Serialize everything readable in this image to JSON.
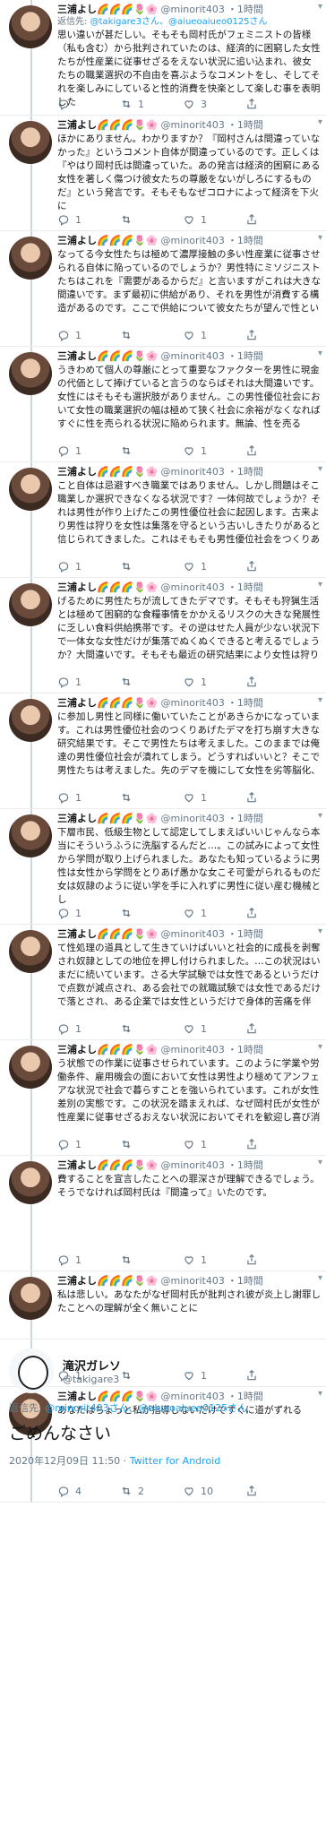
{
  "user": {
    "name": "三浦よし🌈🌈🌈🌷🌸",
    "handle": "@minorit403",
    "time": "・1時間"
  },
  "tweets": [
    {
      "reply_label": "返信先:",
      "reply_to": "@takigare3さん、@aiueoaiueo0125さん",
      "text": "思い違いが甚だしい。そもそも岡村氏がフェミニストの皆様（私も含む）から批判されていたのは、経済的に困窮した女性たちが性産業に従事せざるをえない状況に追い込まれ、彼女たちの職業選択の不自由を喜ぶようなコメントをし、そしてそれを楽しみにしていると性的消費を快楽として楽しむ事を表明した",
      "replies": "",
      "retweets": "1",
      "likes": "3"
    },
    {
      "text": "ほかにありません。わかりますか？『岡村さんは間違っていなかった』というコメント自体が間違っているのです。正しくは『やはり岡村氏は間違っていた。あの発言は経済的困窮にある女性を著しく傷つけ彼女たちの尊厳をないがしろにするものだ』という発言です。そもそもなぜコロナによって経済を下火に",
      "replies": "1",
      "retweets": "",
      "likes": "1"
    },
    {
      "text": "なってる今女性たちは極めて濃厚接触の多い性産業に従事させられる自体に陥っているのでしょうか？男性特にミソジニストたちはこれを『需要があるからだ』と言いますがこれは大きな間違いです。まず最初に供給があり、それを男性が消費する構造があるのです。ここで供給について彼女たちが望んで性とい",
      "replies": "1",
      "retweets": "",
      "likes": "1"
    },
    {
      "text": "うきわめて個人の尊厳にとって重要なファクターを男性に現金の代価として捧げていると言うのならばそれは大間違いです。女性にはそもそも選択肢がありません。この男性優位社会において女性の職業選択の幅は極めて狭く社会に余裕がなくなればすぐに性を売られる状況に陥められます。無論、性を売る",
      "replies": "1",
      "retweets": "",
      "likes": "1"
    },
    {
      "text": "こと自体は忌避すべき職業ではありません。しかし問題はそこ職業しか選択できなくなる状況です？一体何故でしょうか？それは男性が作り上げたこの男性優位社会に起因します。古来より男性は狩りを女性は集落を守るという古いしきたりがあると信じられてきました。これはそもそも男性優位社会をつくりあ",
      "replies": "1",
      "retweets": "",
      "likes": "1"
    },
    {
      "text": "げるために男性たちが流してきたデマです。そもそも狩猟生活とは極めて困窮的な食糧事情をかかえるリスクの大きな発展性に乏しい食料供給携帯です。その逆はせた人員が少ない状況下で一体女な女性だけが集落でぬくぬくできると考えるでしょうか？大間違いです。そもそも最近の研究結果により女性は狩り",
      "replies": "1",
      "retweets": "",
      "likes": "1"
    },
    {
      "text": "に参加し男性と同様に働いていたことがあきらかになっています。これは男性優位社会のつくりあげたデマを打ち崩す大きな研究結果です。そこで男性たちは考えました。このままでは俺達の男性優位社会が潰れてしまう。どうすればいいと？そこで男性たちは考えました。先のデマを機にして女性を劣等脳化、",
      "replies": "1",
      "retweets": "",
      "likes": "1"
    },
    {
      "text": "下層市民、低級生物として認定してしまえばいいじゃんなら本当にそういうふうに洗脳するんだと…。この試みによって女性から学問が取り上げられました。あなたも知っているように男性は女性から学問をとりあげ愚かな女こそ可愛がられるものだ女は奴隷のように従い学を手に入れずに男性に従い産む機械とし",
      "replies": "1",
      "retweets": "",
      "likes": "1"
    },
    {
      "text": "て性処理の道具として生きていけばいいと社会的に成長を剥奪され奴隷としての地位を押し付けられました。…この状況はいまだに続いています。さる大学試験では女性であるというだけで点数が減点され、ある会社での就職試験では女性であるだけで落とされ、ある企業では女性というだけで身体的苦痛を伴",
      "replies": "1",
      "retweets": "",
      "likes": "1"
    },
    {
      "text": "う状態での作業に従事させられています。このように学業や労働条件、雇用機会の面において女性は男性より極めてアンフェアな状況で社会で暮らすことを強いられています。これが女性差別の実態です。この状況を踏まえれば、なぜ岡村氏が女性が性産業に従事せざるおえない状況においてそれを歓迎し喜び消",
      "replies": "1",
      "retweets": "",
      "likes": "1"
    },
    {
      "text": "費することを宣言したことへの罪深さが理解できるでしょう。そうでなければ岡村氏は『間違って』いたのです。",
      "replies": "1",
      "retweets": "",
      "likes": "1"
    },
    {
      "text": "私は悲しい。あなたがなぜ岡村氏が批判され彼が炎上し謝罪したことへの理解が全く無いことに",
      "replies": "1",
      "retweets": "",
      "likes": "1"
    },
    {
      "text": "あなたはちょっと私が指導しないだけですぐに道がずれる",
      "replies": "4",
      "retweets": "2",
      "likes": "10"
    }
  ],
  "focused": {
    "name": "滝沢ガレソ",
    "handle": "@takigare3",
    "reply_label": "返信先:",
    "reply_to": "@minorit403さん、@aiueoaiueo0125さん",
    "text": "ごめんなさい",
    "date": "2020年12月09日 11:50",
    "source": "Twitter for Android"
  }
}
